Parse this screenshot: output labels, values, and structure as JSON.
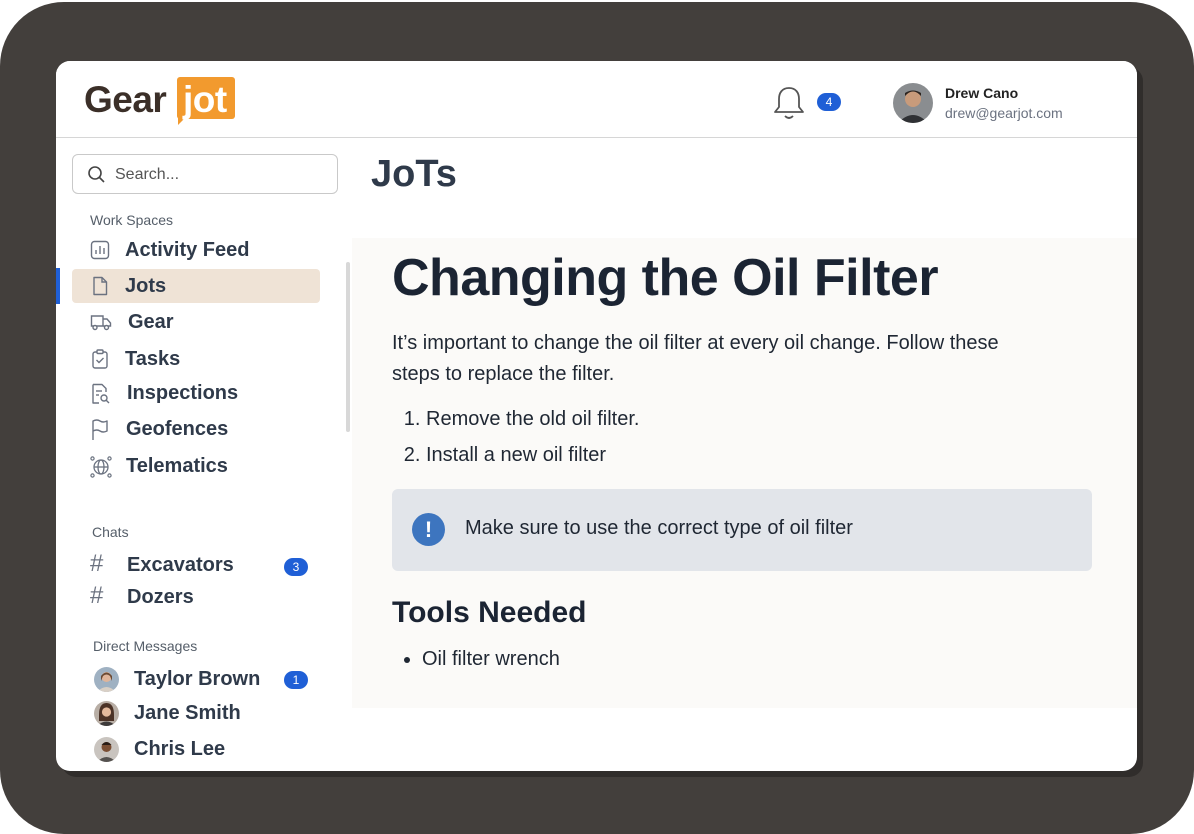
{
  "brand": {
    "part1": "Gear",
    "part2": "jot"
  },
  "header": {
    "notification_count": "4",
    "user": {
      "name": "Drew Cano",
      "email": "drew@gearjot.com"
    }
  },
  "search": {
    "placeholder": "Search..."
  },
  "sidebar": {
    "workspaces_label": "Work Spaces",
    "items": [
      {
        "label": "Activity Feed",
        "icon": "bar-chart-icon"
      },
      {
        "label": "Jots",
        "icon": "document-icon",
        "active": true
      },
      {
        "label": "Gear",
        "icon": "truck-icon"
      },
      {
        "label": "Tasks",
        "icon": "clipboard-check-icon"
      },
      {
        "label": "Inspections",
        "icon": "inspection-search-icon"
      },
      {
        "label": "Geofences",
        "icon": "flag-icon"
      },
      {
        "label": "Telematics",
        "icon": "globe-network-icon"
      }
    ],
    "chats_label": "Chats",
    "chats": [
      {
        "label": "Excavators",
        "badge": "3"
      },
      {
        "label": "Dozers"
      }
    ],
    "dm_label": "Direct Messages",
    "dms": [
      {
        "label": "Taylor Brown",
        "badge": "1"
      },
      {
        "label": "Jane Smith"
      },
      {
        "label": "Chris Lee"
      }
    ]
  },
  "main": {
    "title": "JoTs",
    "doc": {
      "heading": "Changing the Oil Filter",
      "intro": "It’s important to change the oil filter at every oil change. Follow these steps to replace the filter.",
      "steps": [
        "Remove the old oil filter.",
        "Install a new oil filter"
      ],
      "callout": "Make sure to use the correct type of oil filter",
      "tools_heading": "Tools Needed",
      "tools": [
        "Oil filter wrench"
      ]
    }
  },
  "colors": {
    "accent": "#1f5fd6",
    "brand_orange": "#f29a2e",
    "active_bg": "#efe3d6"
  }
}
